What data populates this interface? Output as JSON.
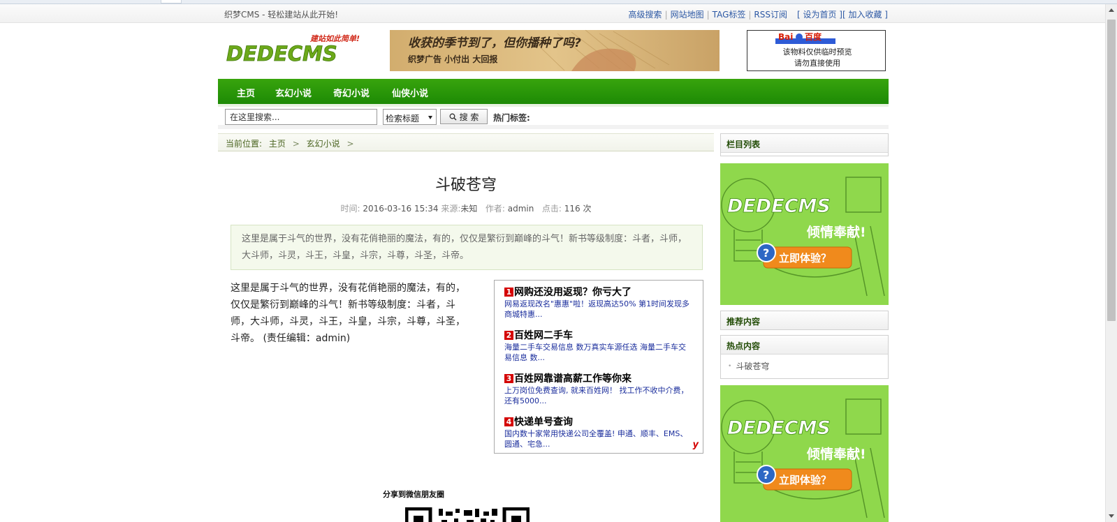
{
  "topbar": {
    "welcome": "织梦CMS - 轻松建站从此开始!",
    "links": [
      "高级搜索",
      "网站地图",
      "TAG标签",
      "RSS订阅"
    ],
    "right_links": [
      "[ 设为首页 ]",
      "[ 加入收藏 ]"
    ]
  },
  "logo": {
    "text": "DEDECMS",
    "slogan": "建站如此简单!"
  },
  "banner1": {
    "headline": "收获的季节到了，但你播种了吗?",
    "sub": "织梦广告  小付出  大回报"
  },
  "banner2": {
    "brand": "百度",
    "line1": "该物料仅供临时预览",
    "line2": "请勿直接使用"
  },
  "nav": {
    "items": [
      "主页",
      "玄幻小说",
      "奇幻小说",
      "仙侠小说"
    ]
  },
  "search": {
    "value": "在这里搜索...",
    "select_value": "检索标题",
    "button_label": "搜 索",
    "hot_label": "热门标签:"
  },
  "breadcrumb": {
    "prefix": "当前位置:",
    "items": [
      "主页",
      "玄幻小说"
    ]
  },
  "article": {
    "title": "斗破苍穹",
    "meta": {
      "time_label": "时间:",
      "time": "2016-03-16 15:34",
      "source_label": "来源:",
      "source": "未知",
      "author_label": "作者:",
      "author": "admin",
      "clicks_label": "点击:",
      "clicks": "116",
      "clicks_unit": "次"
    },
    "summary": "这里是属于斗气的世界，没有花俏艳丽的魔法，有的，仅仅是繁衍到巅峰的斗气！新书等级制度：斗者，斗师，大斗师，斗灵，斗王，斗皇，斗宗，斗尊，斗圣，斗帝。",
    "body": "这里是属于斗气的世界，没有花俏艳丽的魔法，有的，仅仅是繁衍到巅峰的斗气！新书等级制度：斗者，斗师，大斗师，斗灵，斗王，斗皇，斗宗，斗尊，斗圣，斗帝。 (责任编辑：admin)"
  },
  "ads": {
    "items": [
      {
        "num": "1",
        "title": "网购还没用返现？你亏大了",
        "desc": "网易返现改名\"惠惠\"啦！返现高达50% 第1时间发现多商城特惠..."
      },
      {
        "num": "2",
        "title": "百姓网二手车",
        "desc": "海量二手车交易信息 数万真实车源任选 海量二手车交易信息 数..."
      },
      {
        "num": "3",
        "title": "百姓网靠谱高薪工作等你来",
        "desc": "上万岗位免费查询, 就来百姓网！ 找工作不收中介费，还有5000..."
      },
      {
        "num": "4",
        "title": "快递单号查询",
        "desc": "国内数十家常用快递公司全覆盖! 申通、顺丰、EMS、圆通、宅急..."
      }
    ],
    "logo": "y"
  },
  "share": {
    "title": "分享到微信朋友圈"
  },
  "sidebar": {
    "column_list_title": "栏目列表",
    "recommend_title": "推荐内容",
    "hot_title": "热点内容",
    "hot_items": [
      "斗破苍穹"
    ],
    "promo": {
      "brand": "DEDECMS",
      "tagline": "倾情奉献!",
      "cta": "立即体验？"
    }
  },
  "colors": {
    "nav_green": "#2a9a08",
    "link_blue": "#2c58a4",
    "ad_red": "#d40000",
    "promo_green": "#8fd84c",
    "cta_orange": "#f08a1c"
  }
}
